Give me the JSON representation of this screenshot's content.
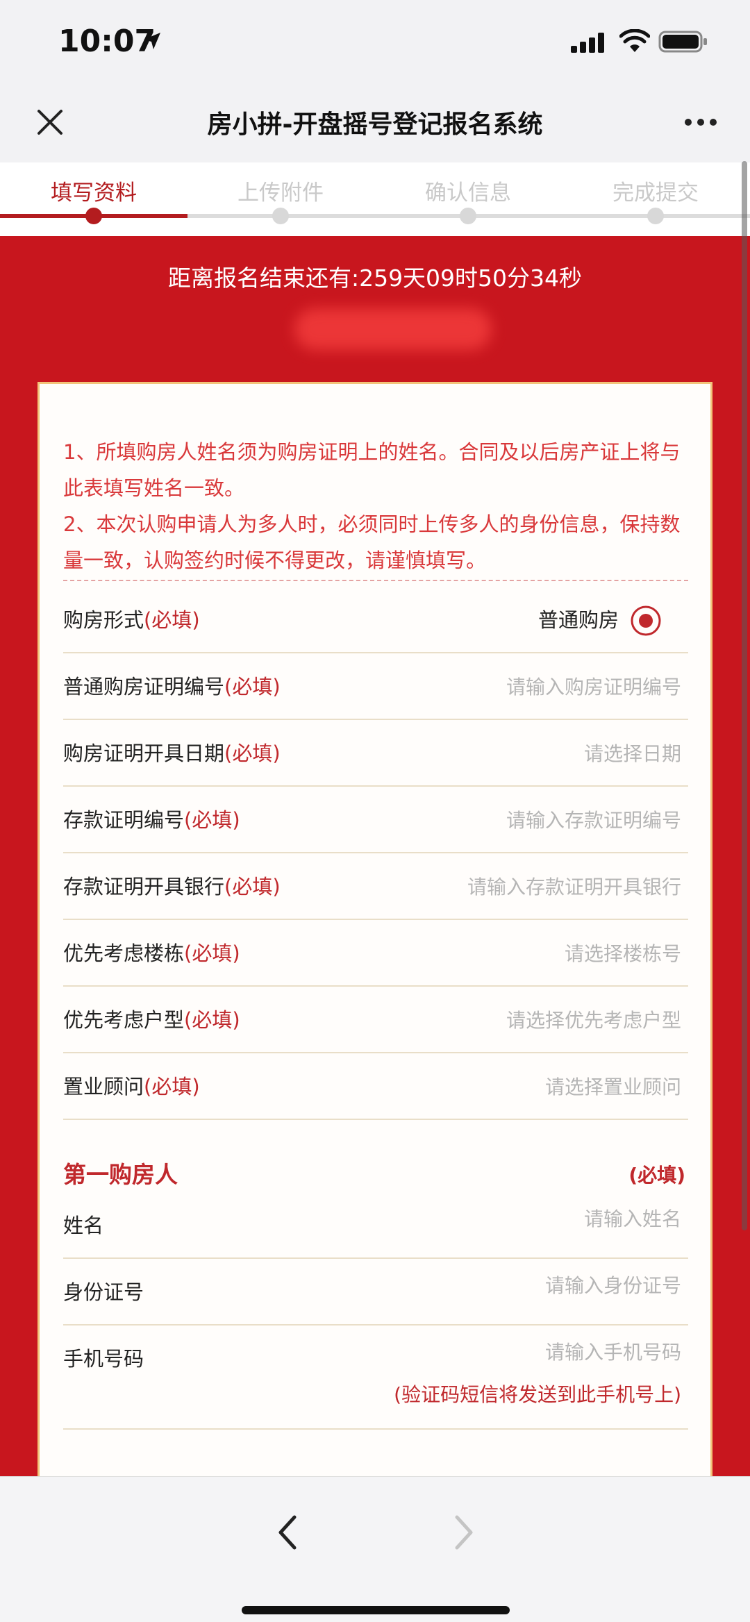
{
  "status_bar": {
    "time": "10:07"
  },
  "nav": {
    "title": "房小拼-开盘摇号登记报名系统"
  },
  "steps": [
    {
      "label": "填写资料",
      "active": true
    },
    {
      "label": "上传附件",
      "active": false
    },
    {
      "label": "确认信息",
      "active": false
    },
    {
      "label": "完成提交",
      "active": false
    }
  ],
  "countdown": "距离报名结束还有:259天09时50分34秒",
  "notice": {
    "line1": "1、所填购房人姓名须为购房证明上的姓名。合同及以后房产证上将与此表填写姓名一致。",
    "line2": "2、本次认购申请人为多人时，必须同时上传多人的身份信息，保持数量一致，认购签约时候不得更改，请谨慎填写。"
  },
  "required_mark": "(必填)",
  "form": {
    "purchase_type": {
      "label": "购房形式",
      "value": "普通购房"
    },
    "certificate_no": {
      "label": "普通购房证明编号",
      "placeholder": "请输入购房证明编号"
    },
    "certificate_date": {
      "label": "购房证明开具日期",
      "placeholder": "请选择日期"
    },
    "deposit_no": {
      "label": "存款证明编号",
      "placeholder": "请输入存款证明编号"
    },
    "deposit_bank": {
      "label": "存款证明开具银行",
      "placeholder": "请输入存款证明开具银行"
    },
    "building": {
      "label": "优先考虑楼栋",
      "placeholder": "请选择楼栋号"
    },
    "unit_type": {
      "label": "优先考虑户型",
      "placeholder": "请选择优先考虑户型"
    },
    "consultant": {
      "label": "置业顾问",
      "placeholder": "请选择置业顾问"
    }
  },
  "buyer1": {
    "title": "第一购房人",
    "required": "(必填)",
    "name": {
      "label": "姓名",
      "placeholder": "请输入姓名"
    },
    "id_no": {
      "label": "身份证号",
      "placeholder": "请输入身份证号"
    },
    "phone": {
      "label": "手机号码",
      "placeholder": "请输入手机号码",
      "note": "(验证码短信将发送到此手机号上)"
    }
  },
  "colors": {
    "primary_red": "#c8161e",
    "accent_red": "#c0282c",
    "card_border": "#f2c47a"
  }
}
